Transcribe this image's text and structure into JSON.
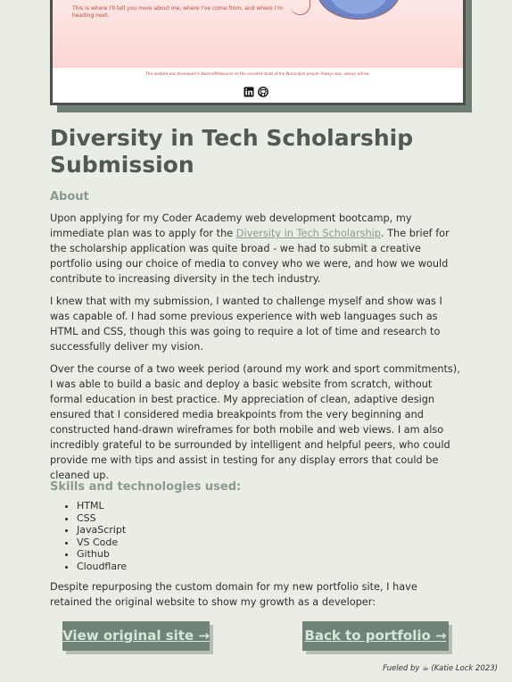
{
  "preview": {
    "intro": "This is where I'll tell you more about me, where I've come from, and where I'm heading next.",
    "footer_note": "This website was developed in Naarm/Melbourne on the unceded lands of the Wurundjeri people. Always was, always will be.",
    "icons": [
      "linkedin-icon",
      "github-icon"
    ]
  },
  "title": "Diversity in Tech Scholarship Submission",
  "about_heading": "About",
  "para1": {
    "before": "Upon applying for my Coder Academy web development bootcamp, my immediate plan was to apply for the ",
    "link": "Diversity in Tech Scholarship",
    "after": ". The brief for the scholarship application was quite broad - we had to submit a creative portfolio using our choice of media to convey who we were, and how we would contribute to increasing diversity in the tech industry."
  },
  "para2": "I knew that with my submission, I wanted to challenge myself and show was I was capable of. I had some previous experience with web languages such as HTML and CSS, though this was going to require a lot of time and research to successfully deliver my vision.",
  "para3": "Over the course of a two week period (around my work and sport commitments), I was able to build a basic and deploy a basic website from scratch, without formal education in best practice. My appreciation of clean, adaptive design ensured that I considered media breakpoints from the very beginning and constructed hand-drawn wireframes for both mobile and web views. I am also incredibly grateful to be surrounded by intelligent and helpful peers, who could provide me with tips and assist in testing for any display errors that could be cleaned up.",
  "skills_heading": "Skills and technologies used:",
  "skills": [
    "HTML",
    "CSS",
    "JavaScript",
    "VS Code",
    "Github",
    "Cloudflare"
  ],
  "para4": "Despite repurposing the custom domain for my new portfolio site, I have retained the original website to show my growth as a developer:",
  "buttons": {
    "view_original": "View original site →",
    "back_portfolio": "Back to portfolio →"
  },
  "credit": "Fueled by ☕ (Katie Lock 2023)",
  "colors": {
    "background": "#e9ede4",
    "button": "#6f8477",
    "heading": "#505a55",
    "subheading": "#8a9a90"
  }
}
